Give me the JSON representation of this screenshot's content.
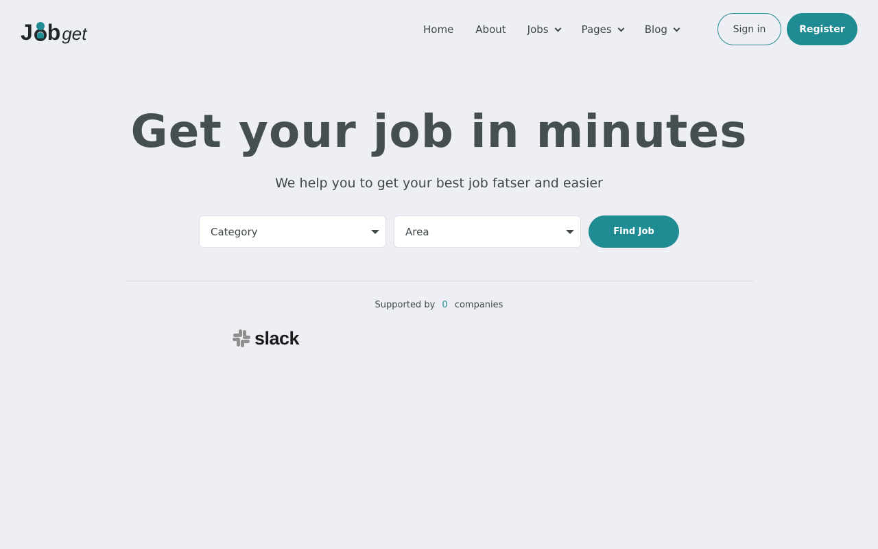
{
  "brand": {
    "logo_text_j": "J",
    "logo_text_b": "b",
    "logo_text_get": "get",
    "accent_color": "#1f8c93"
  },
  "nav": {
    "items": [
      {
        "label": "Home",
        "has_dropdown": false
      },
      {
        "label": "About",
        "has_dropdown": false
      },
      {
        "label": "Jobs",
        "has_dropdown": true
      },
      {
        "label": "Pages",
        "has_dropdown": true
      },
      {
        "label": "Blog",
        "has_dropdown": true
      }
    ],
    "signin_label": "Sign in",
    "register_label": "Register"
  },
  "hero": {
    "title": "Get your job in minutes",
    "subtitle": "We help you to get your best job fatser and easier"
  },
  "search": {
    "category_value": "Category",
    "area_value": "Area",
    "find_label": "Find Job"
  },
  "supported": {
    "prefix": "Supported by",
    "count": "0",
    "suffix": "companies"
  },
  "companies": [
    {
      "name": "slack",
      "icon": "slack-icon"
    }
  ]
}
